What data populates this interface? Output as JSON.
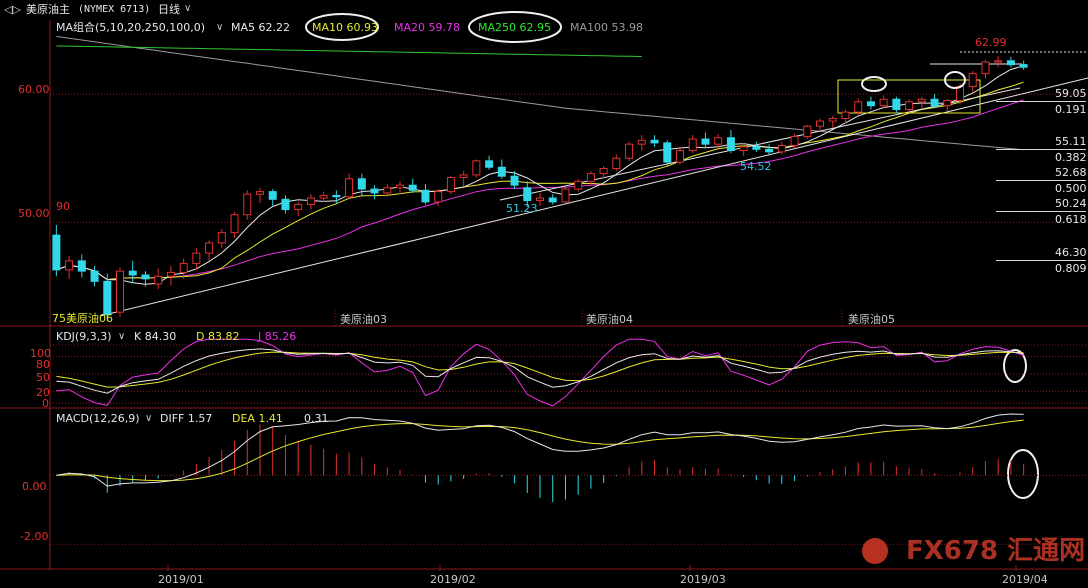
{
  "header": {
    "back_label": "◁▷",
    "symbol": "美原油主",
    "code": "(NYMEX 6713)",
    "period": "日线"
  },
  "ma_legend": {
    "name": "MA组合(5,10,20,250,100,0)",
    "items": [
      {
        "label": "MA5 62.22",
        "color": "#e8e8e8"
      },
      {
        "label": "MA10 60.93",
        "color": "#e8e830"
      },
      {
        "label": "MA20 59.78",
        "color": "#e830e8"
      },
      {
        "label": "MA250 62.95",
        "color": "#30e830"
      },
      {
        "label": "MA100 53.98",
        "color": "#9a9a9a"
      }
    ]
  },
  "price_axis": {
    "ticks": [
      {
        "label": "60.00",
        "value": 60
      },
      {
        "label": "50.00",
        "value": 50
      }
    ]
  },
  "macd_axis": {
    "ticks": [
      {
        "label": "0.00",
        "value": 0
      },
      {
        "label": "-2.00",
        "value": -2
      }
    ]
  },
  "kdj_axis": {
    "ticks": [
      {
        "label": "100",
        "value": 100
      },
      {
        "label": "80",
        "value": 80
      },
      {
        "label": "50",
        "value": 50
      },
      {
        "label": "20",
        "value": 20
      },
      {
        "label": "0",
        "value": 0
      }
    ]
  },
  "annotations": {
    "high": "62.99",
    "low1": "51.23",
    "low2": "54.52",
    "left_low": "75美原油06",
    "left_start": "90"
  },
  "fib_levels": [
    {
      "price": "59.05",
      "ratio": "0.191"
    },
    {
      "price": "55.11",
      "ratio": "0.382"
    },
    {
      "price": "52.68",
      "ratio": "0.500"
    },
    {
      "price": "50.24",
      "ratio": "0.618"
    },
    {
      "price": "46.30",
      "ratio": "0.809"
    }
  ],
  "contract_labels": [
    "美原油03",
    "美原油04",
    "美原油05"
  ],
  "kdj_legend": {
    "name": "KDJ(9,3,3)",
    "k": "K 84.30",
    "d": "D 83.82",
    "j": "J 85.26"
  },
  "macd_legend": {
    "name": "MACD(12,26,9)",
    "diff": "DIFF 1.57",
    "dea": "DEA 1.41",
    "macd": "0.31"
  },
  "date_axis": [
    "2019/01",
    "2019/02",
    "2019/03",
    "2019/04"
  ],
  "watermark": "FX678 汇通网",
  "chart_data": {
    "type": "candlestick",
    "ylim": [
      42,
      65
    ],
    "candles": [
      [
        49.0,
        49.8,
        45.8,
        46.3
      ],
      [
        46.3,
        47.4,
        45.6,
        47.0
      ],
      [
        47.0,
        47.5,
        45.7,
        46.2
      ],
      [
        46.2,
        46.6,
        45.0,
        45.4
      ],
      [
        45.4,
        46.0,
        42.3,
        42.8
      ],
      [
        43.0,
        46.5,
        42.6,
        46.2
      ],
      [
        46.2,
        47.0,
        45.3,
        45.9
      ],
      [
        45.9,
        46.2,
        45.0,
        45.6
      ],
      [
        45.2,
        46.4,
        44.8,
        45.8
      ],
      [
        45.8,
        46.6,
        45.1,
        46.1
      ],
      [
        46.1,
        47.2,
        45.6,
        46.8
      ],
      [
        46.8,
        48.0,
        46.3,
        47.6
      ],
      [
        47.6,
        48.6,
        47.0,
        48.4
      ],
      [
        48.4,
        49.5,
        48.0,
        49.2
      ],
      [
        49.2,
        50.8,
        48.8,
        50.6
      ],
      [
        50.6,
        52.5,
        50.2,
        52.2
      ],
      [
        52.2,
        52.7,
        51.5,
        52.4
      ],
      [
        52.4,
        52.6,
        51.3,
        51.8
      ],
      [
        51.8,
        52.1,
        50.7,
        51.0
      ],
      [
        51.0,
        51.6,
        50.5,
        51.4
      ],
      [
        51.4,
        52.2,
        51.0,
        51.9
      ],
      [
        51.9,
        52.4,
        51.6,
        52.1
      ],
      [
        52.1,
        52.5,
        51.5,
        52.0
      ],
      [
        52.0,
        53.8,
        51.9,
        53.4
      ],
      [
        53.4,
        53.8,
        52.1,
        52.6
      ],
      [
        52.6,
        52.9,
        51.8,
        52.3
      ],
      [
        52.3,
        53.0,
        52.0,
        52.7
      ],
      [
        52.7,
        53.2,
        52.2,
        52.9
      ],
      [
        52.9,
        53.4,
        52.3,
        52.5
      ],
      [
        52.5,
        53.0,
        51.4,
        51.6
      ],
      [
        51.6,
        52.6,
        51.3,
        52.4
      ],
      [
        52.4,
        53.6,
        52.2,
        53.5
      ],
      [
        53.5,
        54.0,
        52.8,
        53.7
      ],
      [
        53.7,
        54.9,
        53.5,
        54.8
      ],
      [
        54.8,
        55.2,
        54.1,
        54.3
      ],
      [
        54.3,
        54.9,
        53.4,
        53.6
      ],
      [
        53.6,
        54.0,
        52.6,
        52.9
      ],
      [
        52.7,
        53.2,
        51.2,
        51.7
      ],
      [
        51.7,
        52.3,
        51.3,
        51.9
      ],
      [
        51.9,
        52.2,
        51.4,
        51.6
      ],
      [
        51.6,
        52.8,
        51.5,
        52.6
      ],
      [
        52.6,
        53.4,
        52.4,
        53.2
      ],
      [
        53.2,
        54.0,
        52.9,
        53.8
      ],
      [
        53.8,
        54.4,
        53.4,
        54.2
      ],
      [
        54.2,
        55.3,
        54.0,
        55.0
      ],
      [
        55.0,
        56.3,
        54.8,
        56.1
      ],
      [
        56.1,
        56.8,
        55.6,
        56.4
      ],
      [
        56.4,
        56.8,
        55.9,
        56.2
      ],
      [
        56.2,
        56.4,
        54.4,
        54.7
      ],
      [
        54.7,
        55.9,
        54.5,
        55.6
      ],
      [
        55.6,
        56.8,
        55.4,
        56.5
      ],
      [
        56.5,
        57.0,
        55.8,
        56.1
      ],
      [
        56.1,
        56.9,
        55.8,
        56.6
      ],
      [
        56.6,
        57.2,
        55.4,
        55.6
      ],
      [
        55.6,
        56.2,
        55.2,
        55.9
      ],
      [
        55.9,
        56.3,
        55.5,
        55.7
      ],
      [
        55.7,
        56.1,
        55.3,
        55.5
      ],
      [
        55.5,
        56.3,
        55.3,
        56.0
      ],
      [
        56.0,
        56.9,
        55.8,
        56.7
      ],
      [
        56.7,
        57.6,
        56.5,
        57.5
      ],
      [
        57.5,
        58.1,
        57.1,
        57.9
      ],
      [
        57.9,
        58.3,
        57.4,
        58.1
      ],
      [
        58.1,
        58.8,
        57.7,
        58.6
      ],
      [
        58.6,
        59.7,
        58.4,
        59.4
      ],
      [
        59.4,
        59.8,
        58.8,
        59.1
      ],
      [
        59.1,
        59.9,
        58.9,
        59.6
      ],
      [
        59.6,
        59.8,
        58.5,
        58.8
      ],
      [
        58.8,
        59.6,
        58.6,
        59.4
      ],
      [
        59.4,
        59.8,
        58.9,
        59.6
      ],
      [
        59.6,
        60.0,
        58.9,
        59.1
      ],
      [
        59.1,
        59.6,
        58.7,
        59.5
      ],
      [
        59.5,
        60.8,
        59.2,
        60.6
      ],
      [
        60.6,
        61.8,
        60.2,
        61.6
      ],
      [
        61.6,
        62.7,
        61.2,
        62.5
      ],
      [
        62.5,
        62.99,
        62.1,
        62.6
      ],
      [
        62.6,
        62.9,
        62.1,
        62.3
      ],
      [
        62.3,
        62.6,
        61.9,
        62.1
      ]
    ],
    "kdj_range": [
      0,
      100
    ],
    "macd_range": [
      -2.6,
      1.6
    ]
  }
}
